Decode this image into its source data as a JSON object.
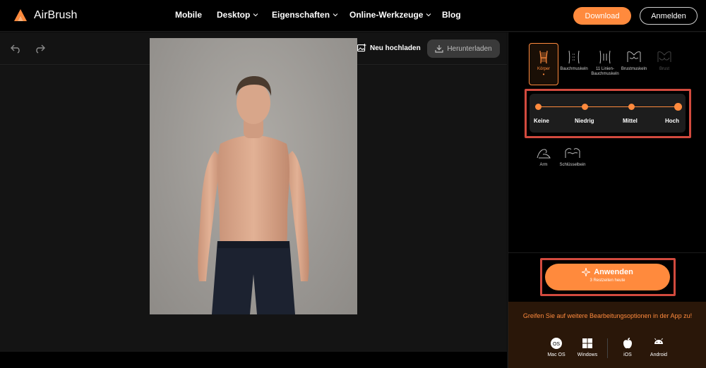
{
  "app": {
    "name": "AirBrush"
  },
  "nav": {
    "links": [
      {
        "label": "Mobile",
        "has_dropdown": false
      },
      {
        "label": "Desktop",
        "has_dropdown": true
      },
      {
        "label": "Eigenschaften",
        "has_dropdown": true
      },
      {
        "label": "Online-Werkzeuge",
        "has_dropdown": true
      },
      {
        "label": "Blog",
        "has_dropdown": false
      }
    ],
    "download_label": "Download",
    "login_label": "Anmelden"
  },
  "toolbar": {
    "upload_label": "Neu hochladen",
    "download_label": "Herunterladen",
    "undo_icon": "undo-icon",
    "redo_icon": "redo-icon"
  },
  "body_areas": {
    "row1": [
      {
        "label": "Körper",
        "selected": true,
        "disabled": false,
        "dot": "•"
      },
      {
        "label": "Bauchmuskeln",
        "selected": false,
        "disabled": false
      },
      {
        "label": "11 Linien-Bauchmuskeln",
        "selected": false,
        "disabled": false
      },
      {
        "label": "Brustmuskeln",
        "selected": false,
        "disabled": false
      },
      {
        "label": "Brust",
        "selected": false,
        "disabled": true
      }
    ],
    "row2": [
      {
        "label": "Arm",
        "selected": false,
        "disabled": false
      },
      {
        "label": "Schlüsselbein",
        "selected": false,
        "disabled": false
      }
    ]
  },
  "intensity": {
    "levels": [
      "Keine",
      "Niedrig",
      "Mittel",
      "Hoch"
    ],
    "selected": "Hoch"
  },
  "apply": {
    "label": "Anwenden",
    "remaining": "3 Restzeiten heute"
  },
  "promo": {
    "text": "Greifen Sie auf weitere Bearbeitungsoptionen in der App zu!",
    "platforms": [
      {
        "label": "Mac OS",
        "icon": "macos-icon"
      },
      {
        "label": "Windows",
        "icon": "windows-icon"
      },
      {
        "label": "iOS",
        "icon": "apple-icon"
      },
      {
        "label": "Android",
        "icon": "android-icon"
      }
    ]
  },
  "colors": {
    "accent": "#ff8a3d",
    "highlight_outline": "#d24a3e",
    "panel_bg": "#000000",
    "promo_bg": "#2a1709"
  }
}
